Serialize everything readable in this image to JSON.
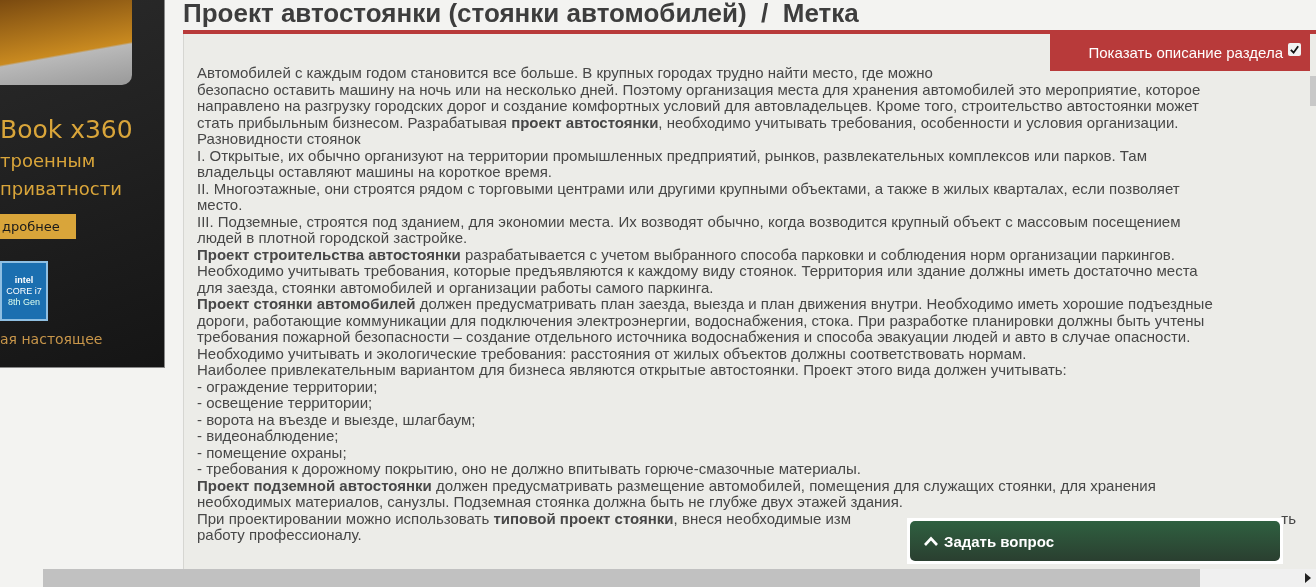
{
  "ad": {
    "headline": "Book x360",
    "lines": [
      "троенным",
      "приватности"
    ],
    "button": "дробнее",
    "badge": {
      "brand": "intel",
      "line1": "CORE i7",
      "line2": "8th Gen"
    },
    "footer": "ая настоящее"
  },
  "title": "Проект автостоянки (стоянки автомобилей)  /  Метка",
  "toggle": {
    "label": "Показать описание раздела",
    "checked": true
  },
  "lines": [
    "Автомобилей с каждым годом становится все больше. В крупных городах трудно найти место, где можно",
    "безопасно оставить машину на ночь или на несколько дней. Поэтому организация места для хранения автомобилей это мероприятие, которое",
    "направлено на разгрузку городских дорог и создание комфортных условий для автовладельцев. Кроме того, строительство автостоянки может",
    "стать прибыльным бизнесом. Разрабатывая **проект автостоянки**, необходимо учитывать требования, особенности и условия организации.",
    "Разновидности стоянок",
    "I. Открытые, их обычно организуют на территории промышленных предприятий, рынков, развлекательных комплексов или парков. Там",
    "владельцы оставляют машины на короткое время.",
    "II. Многоэтажные, они строятся рядом с торговыми центрами или другими крупными объектами, а также в жилых кварталах, если позволяет",
    "место.",
    "III. Подземные, строятся под зданием, для экономии места. Их возводят обычно, когда возводится крупный объект с массовым посещением",
    "людей в плотной городской застройке.",
    "**Проект строительства автостоянки** разрабатывается с учетом выбранного способа парковки и соблюдения норм организации паркингов.",
    "Необходимо учитывать требования, которые предъявляются к каждому виду стоянок. Территория или здание должны иметь достаточно места",
    "для заезда, стоянки автомобилей и организации работы самого паркинга.",
    "**Проект стоянки автомобилей** должен предусматривать план заезда, выезда и план движения внутри. Необходимо иметь хорошие подъездные",
    "дороги, работающие коммуникации для подключения электроэнергии, водоснабжения, стока. При разработке планировки должны быть учтены",
    "требования пожарной безопасности – создание отдельного источника водоснабжения и способа эвакуации людей и авто в случае опасности.",
    "Необходимо учитывать и экологические требования: расстояния от жилых объектов должны соответствовать нормам.",
    "Наиболее привлекательным вариантом для бизнеса являются открытые автостоянки. Проект этого вида должен учитывать:",
    "- ограждение территории;",
    "- освещение территории;",
    "- ворота на въезде и выезде, шлагбаум;",
    "- видеонаблюдение;",
    "- помещение охраны;",
    "- требования к дорожному покрытию, оно не должно впитывать горюче-смазочные материалы.",
    "**Проект подземной автостоянки** должен предусматривать размещение автомобилей, помещения для служащих стоянки, для хранения",
    "необходимых материалов, санузлы. Подземная стоянка должна быть не глубже двух этажей здания."
  ],
  "covered_line": {
    "start": "При проектировании можно использовать **типовой проект стоянки**, внеся необходимые изм",
    "end": "ть"
  },
  "last_line": "работу профессионалу.",
  "chat_button": "Задать вопрос"
}
